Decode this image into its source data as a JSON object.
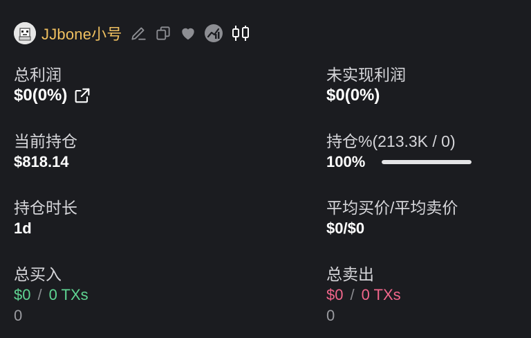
{
  "header": {
    "username": "JJbone小号",
    "icons": [
      "pencil-icon",
      "copy-icon",
      "heart-icon",
      "chart-badge-icon",
      "candlestick-icon"
    ]
  },
  "stats": {
    "total_profit": {
      "label": "总利润",
      "value": "$0(0%)"
    },
    "unrealized_profit": {
      "label": "未实现利润",
      "value": "$0(0%)"
    },
    "current_position": {
      "label": "当前持仓",
      "value": "$818.14"
    },
    "position_pct": {
      "label": "持仓%(213.3K / 0)",
      "value": "100%",
      "progress": 1.0
    },
    "hold_duration": {
      "label": "持仓时长",
      "value": "1d"
    },
    "avg_price": {
      "label": "平均买价/平均卖价",
      "value": "$0/$0"
    },
    "total_buy": {
      "label": "总买入",
      "amount": "$0",
      "separator": "/",
      "txs": "0 TXs",
      "sub": "0"
    },
    "total_sell": {
      "label": "总卖出",
      "amount": "$0",
      "separator": "/",
      "txs": "0 TXs",
      "sub": "0"
    }
  },
  "colors": {
    "background": "#1b1c20",
    "username": "#f0c060",
    "buy": "#5fd492",
    "sell": "#f2668b"
  }
}
